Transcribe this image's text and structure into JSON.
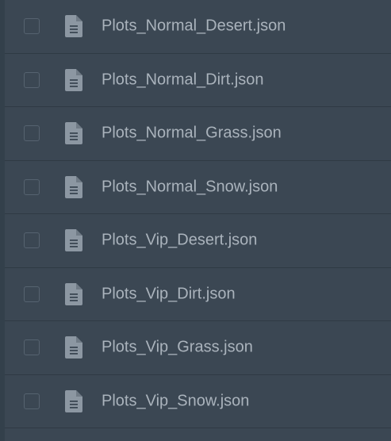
{
  "files": [
    {
      "name": "Plots_Normal_Desert.json",
      "icon": "file-document-icon",
      "checked": false
    },
    {
      "name": "Plots_Normal_Dirt.json",
      "icon": "file-document-icon",
      "checked": false
    },
    {
      "name": "Plots_Normal_Grass.json",
      "icon": "file-document-icon",
      "checked": false
    },
    {
      "name": "Plots_Normal_Snow.json",
      "icon": "file-document-icon",
      "checked": false
    },
    {
      "name": "Plots_Vip_Desert.json",
      "icon": "file-document-icon",
      "checked": false
    },
    {
      "name": "Plots_Vip_Dirt.json",
      "icon": "file-document-icon",
      "checked": false
    },
    {
      "name": "Plots_Vip_Grass.json",
      "icon": "file-document-icon",
      "checked": false
    },
    {
      "name": "Plots_Vip_Snow.json",
      "icon": "file-document-icon",
      "checked": false
    }
  ],
  "colors": {
    "background": "#3b4753",
    "divider": "#2f3a44",
    "text": "#aab3bc",
    "icon": "#8c97a2",
    "checkbox_border": "#566370"
  }
}
